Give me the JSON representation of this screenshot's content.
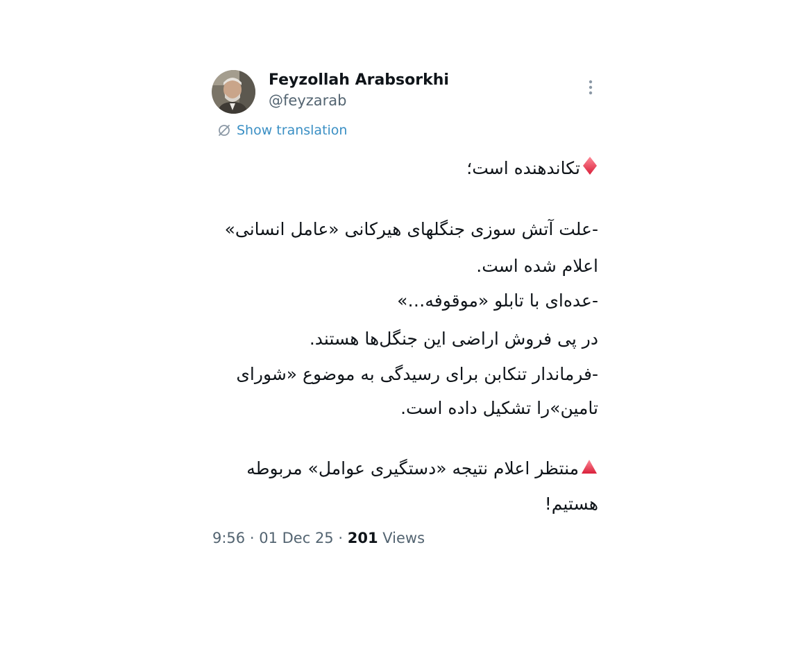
{
  "author": {
    "display_name": "Feyzollah Arabsorkhi",
    "handle": "@feyzarab",
    "avatar_icon": "profile-photo"
  },
  "more_icon": "more-vertical-icon",
  "translation": {
    "icon": "translate-icon",
    "label": "Show translation"
  },
  "tweet_body": {
    "lines": [
      "تکاندهنده است؛",
      "-علت  آتش سوزی جنگلهای هیرکانی «عامل انسانی»",
      "اعلام شده است.",
      "-عده‌ای با تابلو «موقوفه…»",
      "در پی فروش اراضی این جنگل‌ها هستند.",
      "-فرماندار تنکابن برای رسیدگی به موضوع «شورای",
      "تامین»را تشکیل داده است.",
      "منتظر اعلام نتیجه «دستگیری عوامل» مربوطه",
      "هستیم!"
    ],
    "emoji_diamond": "red-diamond",
    "emoji_triangle": "red-triangle"
  },
  "meta": {
    "time": "9:56",
    "date": "01 Dec 25",
    "separator": "·",
    "views_count": "201",
    "views_label": "Views"
  },
  "colors": {
    "link": "#3a8fc4",
    "text": "#0f1419",
    "muted": "#536471",
    "emoji_red": "#e8334a"
  }
}
